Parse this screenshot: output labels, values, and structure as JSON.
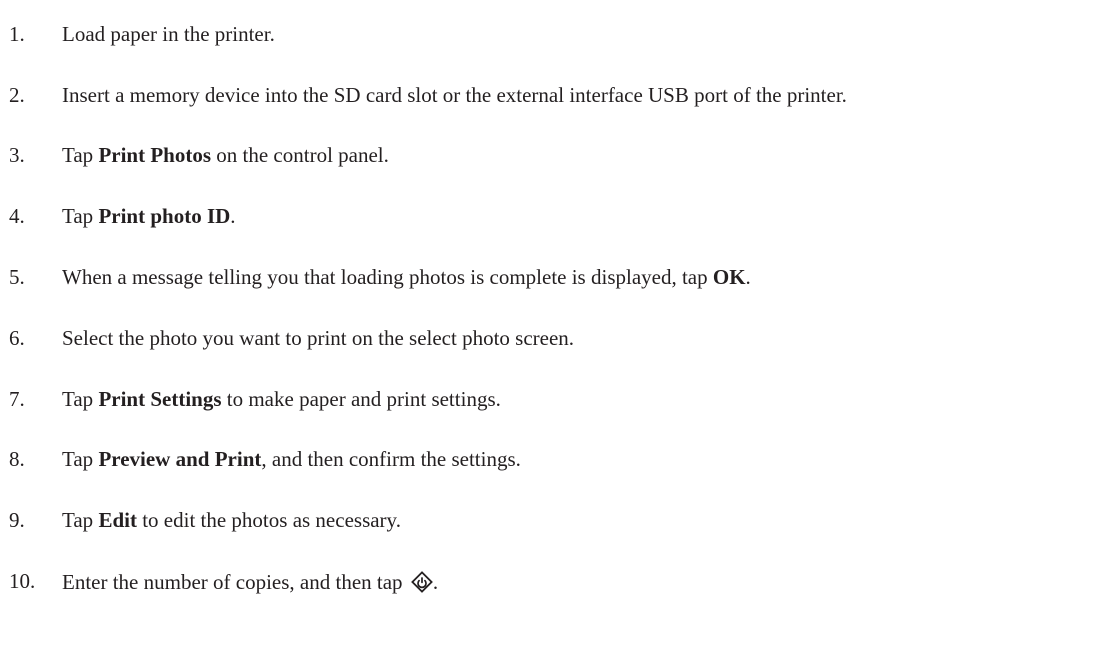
{
  "steps": [
    {
      "num": "1.",
      "parts": [
        {
          "t": "Load paper in the printer."
        }
      ]
    },
    {
      "num": "2.",
      "parts": [
        {
          "t": "Insert a memory device into the SD card slot or the external interface USB port of the printer."
        }
      ]
    },
    {
      "num": "3.",
      "parts": [
        {
          "t": "Tap "
        },
        {
          "t": "Print Photos",
          "b": true
        },
        {
          "t": " on the control panel."
        }
      ]
    },
    {
      "num": "4.",
      "parts": [
        {
          "t": "Tap "
        },
        {
          "t": "Print photo ID",
          "b": true
        },
        {
          "t": "."
        }
      ]
    },
    {
      "num": "5.",
      "parts": [
        {
          "t": "When a message telling you that loading photos is complete is displayed, tap "
        },
        {
          "t": "OK",
          "b": true
        },
        {
          "t": "."
        }
      ]
    },
    {
      "num": "6.",
      "parts": [
        {
          "t": "Select the photo you want to print on the select photo screen."
        }
      ]
    },
    {
      "num": "7.",
      "parts": [
        {
          "t": "Tap "
        },
        {
          "t": "Print Settings",
          "b": true
        },
        {
          "t": " to make paper and print settings."
        }
      ]
    },
    {
      "num": "8.",
      "parts": [
        {
          "t": "Tap "
        },
        {
          "t": "Preview and Print",
          "b": true
        },
        {
          "t": ", and then confirm the settings."
        }
      ]
    },
    {
      "num": "9.",
      "parts": [
        {
          "t": "Tap "
        },
        {
          "t": "Edit",
          "b": true
        },
        {
          "t": " to edit the photos as necessary."
        }
      ]
    },
    {
      "num": "10.",
      "parts": [
        {
          "t": "Enter the number of copies, and then tap "
        },
        {
          "icon": "start-button-icon"
        },
        {
          "t": "."
        }
      ]
    }
  ],
  "colors": {
    "text": "#231f20"
  }
}
